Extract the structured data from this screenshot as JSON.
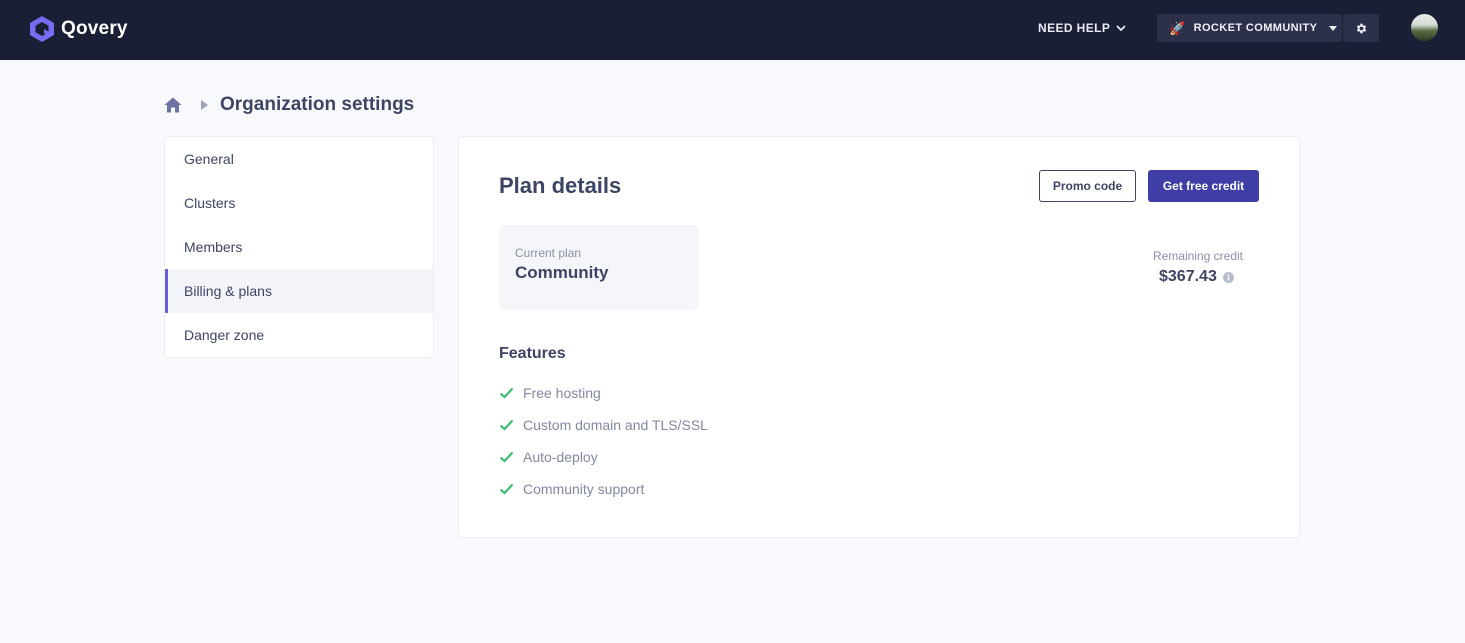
{
  "app": {
    "brand_name": "Qovery",
    "accent_color": "#3f3da6",
    "topbar_color": "#1b1f36"
  },
  "topbar": {
    "need_help_label": "NEED HELP",
    "org_name": "ROCKET COMMUNITY",
    "org_icon": "rocket-icon",
    "settings_icon": "gear-icon"
  },
  "breadcrumb": {
    "home_icon": "home-icon",
    "title": "Organization settings"
  },
  "sidebar": {
    "items": [
      {
        "label": "General",
        "active": false
      },
      {
        "label": "Clusters",
        "active": false
      },
      {
        "label": "Members",
        "active": false
      },
      {
        "label": "Billing & plans",
        "active": true
      },
      {
        "label": "Danger zone",
        "active": false
      }
    ]
  },
  "plan": {
    "title": "Plan details",
    "promo_button": "Promo code",
    "credit_button": "Get free credit",
    "current_plan_label": "Current plan",
    "current_plan_value": "Community",
    "remaining_credit_label": "Remaining credit",
    "remaining_credit_value": "$367.43",
    "features_title": "Features",
    "features": [
      "Free hosting",
      "Custom domain and TLS/SSL",
      "Auto-deploy",
      "Community support"
    ],
    "check_color": "#3fb976"
  }
}
